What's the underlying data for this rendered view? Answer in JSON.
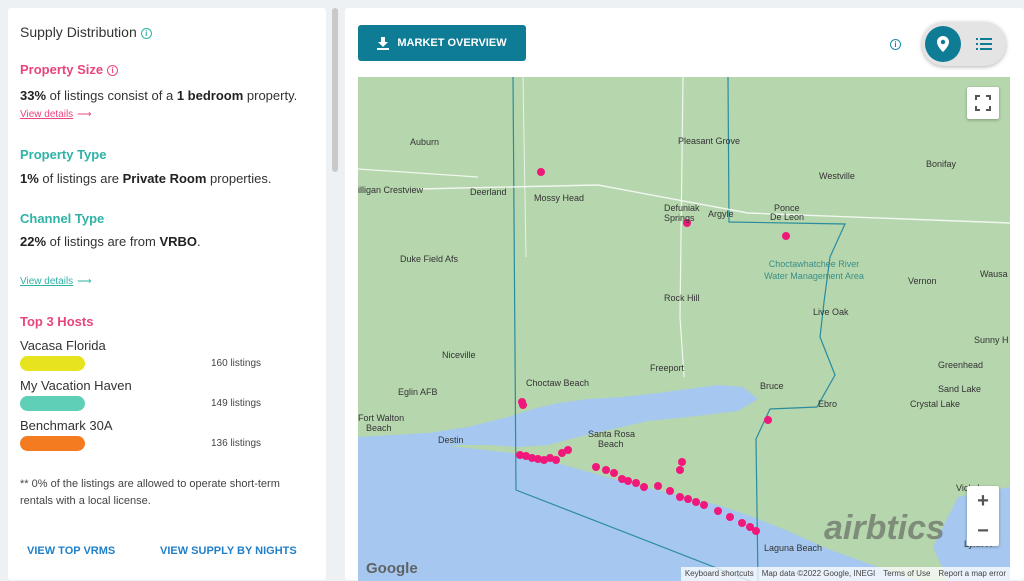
{
  "left": {
    "title": "Supply Distribution",
    "property_size": {
      "heading": "Property Size",
      "pct": "33%",
      "pre": " of listings consist of a ",
      "bold": "1 bedroom",
      "post": " property.",
      "link": "View details"
    },
    "property_type": {
      "heading": "Property Type",
      "pct": "1%",
      "pre": " of listings are ",
      "bold": "Private Room",
      "post": " properties."
    },
    "channel_type": {
      "heading": "Channel Type",
      "pct": "22%",
      "pre": " of listings are from ",
      "bold": "VRBO",
      "post": ".",
      "link": "View details"
    },
    "hosts": {
      "heading": "Top 3 Hosts",
      "items": [
        {
          "name": "Vacasa Florida",
          "count": "160 listings",
          "color": "#e7e41f"
        },
        {
          "name": "My Vacation Haven",
          "count": "149 listings",
          "color": "#5fcfb8"
        },
        {
          "name": "Benchmark 30A",
          "count": "136 listings",
          "color": "#f47b20"
        }
      ]
    },
    "note": "** 0% of the listings are allowed to operate short-term rentals with a local license.",
    "footer_links": [
      "VIEW TOP VRMS",
      "VIEW SUPPLY BY NIGHTS"
    ]
  },
  "right": {
    "market_button": "MARKET OVERVIEW",
    "map": {
      "labels": {
        "auburn": "Auburn",
        "crestview": "illigan Crestview",
        "deerland": "Deerland",
        "mossy_head": "Mossy Head",
        "defuniak": "Defuniak",
        "springs": "Springs",
        "argyle": "Argyle",
        "ponce": "Ponce",
        "de_leon": "De Leon",
        "pleasant_grove": "Pleasant Grove",
        "bonifay": "Bonifay",
        "westville": "Westville",
        "duke_field": "Duke Field Afs",
        "choctaw_water": "Choctawhatchee River Water Management Area",
        "vernon": "Vernon",
        "wausa": "Wausa",
        "rock_hill": "Rock Hill",
        "live_oak": "Live Oak",
        "niceville": "Niceville",
        "sunny_h": "Sunny H",
        "greenhead": "Greenhead",
        "choctaw_beach": "Choctaw Beach",
        "freeport": "Freeport",
        "bruce": "Bruce",
        "sand_lake": "Sand Lake",
        "eglin": "Eglin AFB",
        "fort_walton": "Fort Walton",
        "beach": "Beach",
        "ebro": "Ebro",
        "crystal_lake": "Crystal Lake",
        "destin": "Destin",
        "santa_rosa": "Santa Rosa",
        "santa_beach": "Beach",
        "vicksbur": "Vicksbur",
        "laguna_beach": "Laguna Beach",
        "lynn_h": "Lynn H"
      },
      "attribution": [
        "Keyboard shortcuts",
        "Map data ©2022 Google, INEGI",
        "Terms of Use",
        "Report a map error"
      ],
      "google": "Google",
      "watermark": "airbtics",
      "zoom_in": "+",
      "zoom_out": "−",
      "colors": {
        "marker": "#f0187a",
        "land": "#aed2a6",
        "water": "#a6c8f0",
        "boundary": "#2a8c9e"
      }
    }
  }
}
